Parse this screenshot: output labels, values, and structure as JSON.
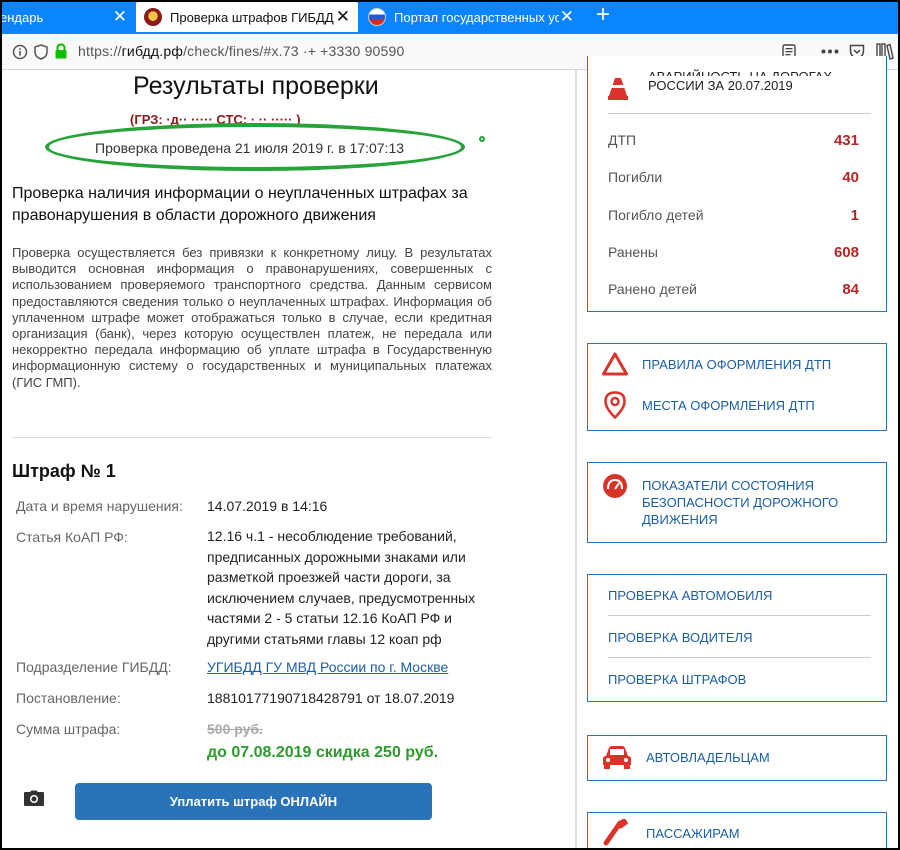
{
  "browser": {
    "tabs": [
      {
        "title": "ендарь",
        "active": false
      },
      {
        "title": "Проверка штрафов ГИБДД",
        "active": true
      },
      {
        "title": "Портал государственных услуг",
        "active": false
      }
    ],
    "close_glyph": "✕",
    "new_tab_glyph": "+",
    "url_host": "гибдд.рф",
    "url_prefix": "https://",
    "url_path": "/check/fines/#x.73    ·+    +3330 90590",
    "icons": [
      "info-icon",
      "shield-icon",
      "lock-icon",
      "reader-view-icon",
      "more-icon",
      "pocket-icon",
      "library-icon"
    ]
  },
  "main": {
    "results_title": "Результаты проверки",
    "grz_line": "(ГРЗ: ·д·· ·····   СТС: ·  ·· ····· )",
    "checked_at": "Проверка проведена 21 июля 2019 г. в 17:07:13",
    "section_title": "Проверка наличия информации о неуплаченных штрафах за правонарушения в области дорожного движения",
    "description": "Проверка осуществляется без привязки к конкретному лицу. В результатах выводится основная информация о правонарушениях, совершенных с использованием проверяемого транспортного средства. Данным сервисом предоставляются сведения только о неуплаченных штрафах. Информация об уплаченном штрафе может отображаться только в случае, если кредитная организация (банк), через которую осуществлен платеж, не передала или некорректно передала информацию об уплате штрафа в Государственную информационную систему о государственных и муниципальных платежах (ГИС ГМП).",
    "fine": {
      "title": "Штраф № 1",
      "date_label": "Дата и время нарушения:",
      "date_value": "14.07.2019 в 14:16",
      "article_label": "Статья КоАП РФ:",
      "article_value": "12.16 ч.1 - несоблюдение требований, предписанных дорожными знаками или разметкой проезжей части дороги, за исключением случаев, предусмотренных частями 2 - 5 статьи 12.16 КоАП РФ и другими статьями главы 12 коап рф",
      "division_label": "Подразделение ГИБДД:",
      "division_value": "УГИБДД ГУ МВД России по г. Москве",
      "resolution_label": "Постановление:",
      "resolution_value": "18810177190718428791 от 18.07.2019",
      "amount_label": "Сумма штрафа:",
      "amount_old": "500 руб.",
      "amount_discount": "до 07.08.2019 скидка 250 руб.",
      "pay_button": "Уплатить штраф ОНЛАЙН"
    }
  },
  "sidebar": {
    "stats": {
      "title_clipped": "АВАРИЙНОСТЬ НА ДОРОГАХ",
      "title_date": "РОССИИ ЗА 20.07.2019",
      "rows": [
        {
          "label": "ДТП",
          "value": "431"
        },
        {
          "label": "Погибли",
          "value": "40"
        },
        {
          "label": "Погибло детей",
          "value": "1"
        },
        {
          "label": "Ранены",
          "value": "608"
        },
        {
          "label": "Ранено детей",
          "value": "84"
        }
      ]
    },
    "dtp_links": [
      "Правила оформления ДТП",
      "Места оформления ДТП"
    ],
    "safety_link": "Показатели состояния безопасности дорожного движения",
    "check_links": [
      "Проверка автомобиля",
      "Проверка водителя",
      "Проверка штрафов"
    ],
    "owners_link": "Автовладельцам",
    "passengers_link": "Пассажирам"
  },
  "colors": {
    "accent": "#2a73b8",
    "browser_blue": "#0a84ff",
    "stat_red": "#b02828",
    "discount_green": "#2c9b2c",
    "ellipse_green": "#27a33a",
    "icon_red": "#d9342b"
  }
}
